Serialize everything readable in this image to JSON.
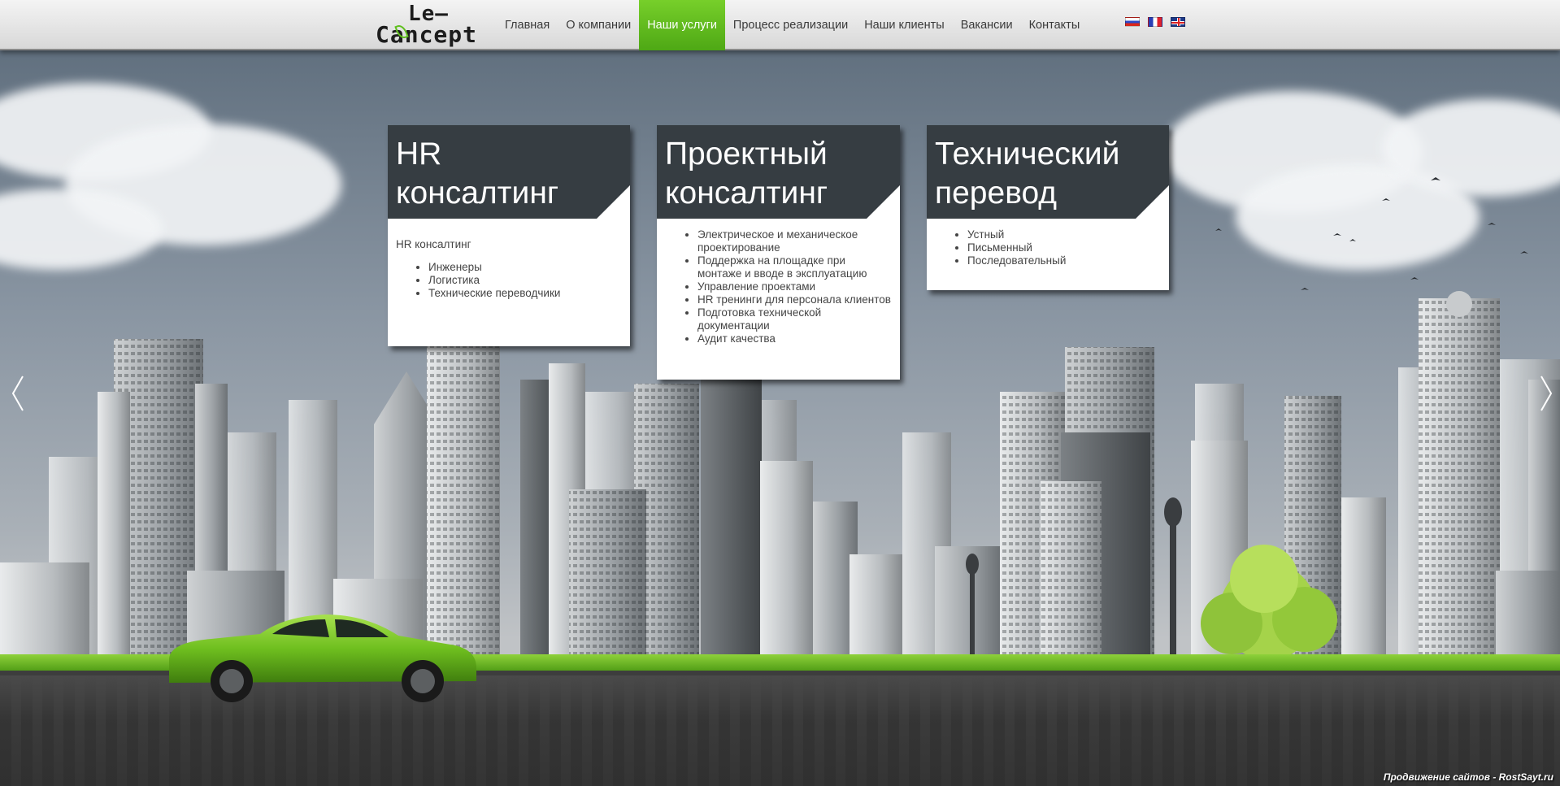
{
  "brand": {
    "logo_line1": "Le–",
    "logo_line2": "Cancept"
  },
  "nav": [
    {
      "label": "Главная",
      "active": false
    },
    {
      "label": "О компании",
      "active": false
    },
    {
      "label": "Наши услуги",
      "active": true
    },
    {
      "label": "Процесс реализации",
      "active": false
    },
    {
      "label": "Наши клиенты",
      "active": false
    },
    {
      "label": "Вакансии",
      "active": false
    },
    {
      "label": "Контакты",
      "active": false
    }
  ],
  "languages": [
    "ru-flag-icon",
    "fr-flag-icon",
    "gb-flag-icon"
  ],
  "cards": [
    {
      "title_line1": "HR",
      "title_line2": "консалтинг",
      "intro": "HR консалтинг",
      "items": [
        "Инженеры",
        "Логистика",
        "Технические переводчики"
      ]
    },
    {
      "title_line1": "Проектный",
      "title_line2": "консалтинг",
      "items": [
        "Электрическое и механическое проектирование",
        "Поддержка на площадке при монтаже и вводе в эксплуатацию",
        "Управление проектами",
        "HR тренинги для персонала клиентов",
        "Подготовка технической документации",
        "Аудит качества"
      ]
    },
    {
      "title_line1": "Технический",
      "title_line2": "перевод",
      "items": [
        "Устный",
        "Письменный",
        "Последовательный"
      ]
    }
  ],
  "slider": {
    "prev_icon": "chevron-left-icon",
    "next_icon": "chevron-right-icon"
  },
  "footer": {
    "promo": "Продвижение сайтов - RostSayt.ru"
  },
  "colors": {
    "accent": "#5fbd1e",
    "card_head": "#363d42",
    "header_bg": "#e6e6e6"
  }
}
